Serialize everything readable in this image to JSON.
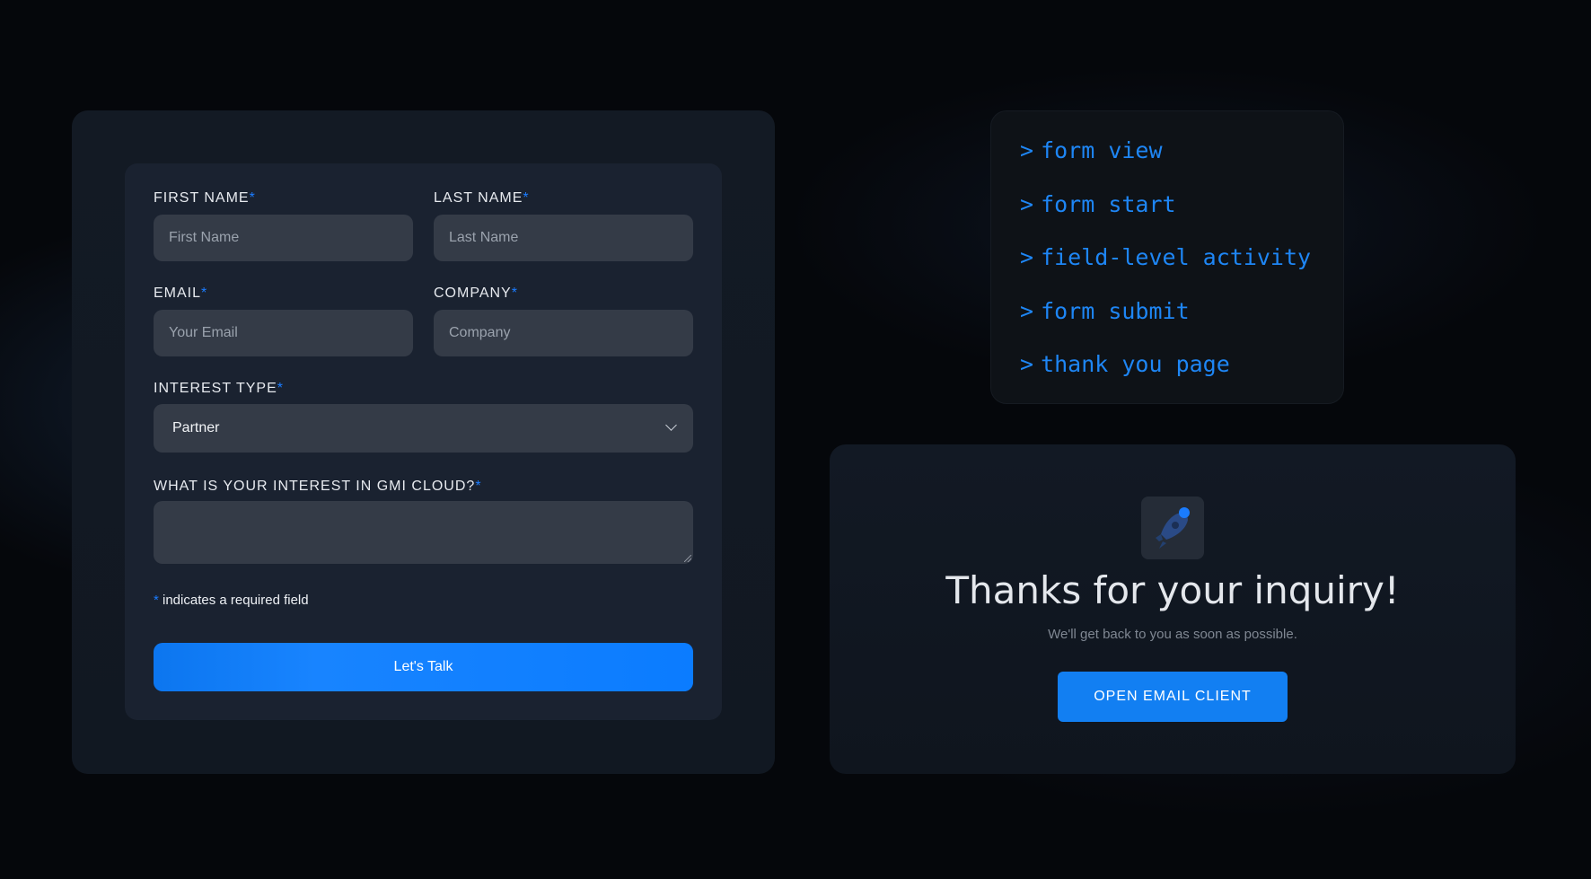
{
  "form": {
    "first_name": {
      "label": "FIRST NAME",
      "required_mark": "*",
      "placeholder": "First Name"
    },
    "last_name": {
      "label": "LAST NAME",
      "required_mark": "*",
      "placeholder": "Last Name"
    },
    "email": {
      "label": "EMAIL",
      "required_mark": "*",
      "placeholder": "Your Email"
    },
    "company": {
      "label": "COMPANY",
      "required_mark": "*",
      "placeholder": "Company"
    },
    "interest_type": {
      "label": "INTEREST TYPE",
      "required_mark": "*",
      "value": "Partner"
    },
    "interest_text": {
      "label": "WHAT IS YOUR INTEREST IN GMI CLOUD?",
      "required_mark": "*",
      "value": ""
    },
    "required_note": {
      "mark": "*",
      "text": " indicates a required field"
    },
    "submit_label": "Let's Talk"
  },
  "terminal": {
    "prompt": ">",
    "lines": [
      "form view",
      "form start",
      "field-level activity",
      "form submit",
      "thank you page"
    ]
  },
  "thanks": {
    "icon": "rocket-icon",
    "title": "Thanks for your inquiry!",
    "subtitle": "We'll get back to you as soon as possible.",
    "button_label": "OPEN EMAIL CLIENT"
  },
  "colors": {
    "accent": "#0b7cff",
    "terminal_text": "#1e86f5",
    "background": "#05070b"
  }
}
